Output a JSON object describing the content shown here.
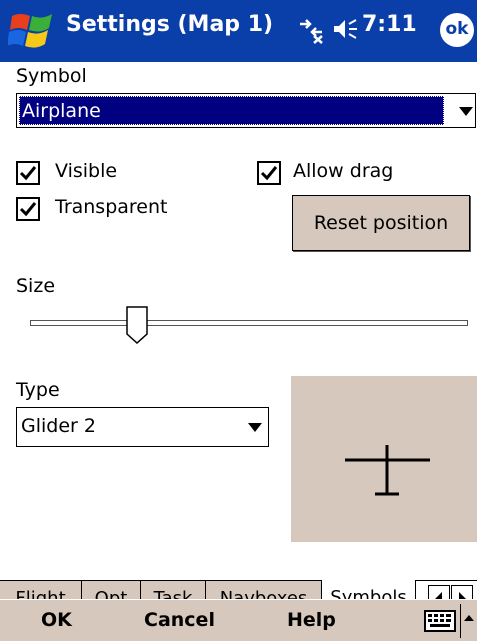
{
  "window": {
    "title": "Settings (Map 1)",
    "clock": "7:11",
    "ok_label": "ok"
  },
  "symbol": {
    "label": "Symbol",
    "selected": "Airplane"
  },
  "options": {
    "visible_label": "Visible",
    "visible_checked": true,
    "transparent_label": "Transparent",
    "transparent_checked": true,
    "allow_drag_label": "Allow drag",
    "allow_drag_checked": true,
    "reset_position_label": "Reset position"
  },
  "size": {
    "label": "Size",
    "level_fraction": 0.23
  },
  "type": {
    "label": "Type",
    "selected": "Glider 2"
  },
  "tabs": [
    {
      "label": "Flight",
      "active": false
    },
    {
      "label": "Opt",
      "active": false
    },
    {
      "label": "Task",
      "active": false
    },
    {
      "label": "Navboxes",
      "active": false
    },
    {
      "label": "Symbols",
      "active": true
    }
  ],
  "menubar": {
    "ok": "OK",
    "cancel": "Cancel",
    "help": "Help"
  },
  "icons": {
    "start": "windows-flag-icon",
    "connectivity": "connectivity-icon",
    "volume": "speaker-icon",
    "keyboard": "keyboard-icon",
    "glider_preview": "glider-symbol-icon"
  },
  "colors": {
    "titlebar": "#0a3ea8",
    "selection": "#000080",
    "panel": "#d6c8bc"
  }
}
